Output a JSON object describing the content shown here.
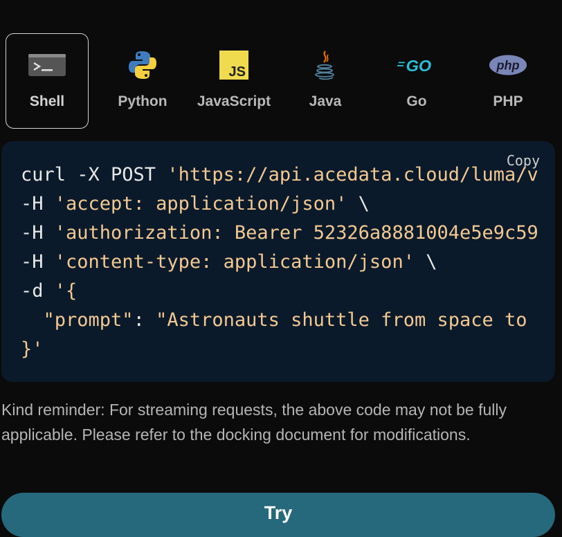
{
  "tabs": [
    {
      "label": "Shell",
      "icon": "terminal-icon",
      "active": true
    },
    {
      "label": "Python",
      "icon": "python-logo-icon",
      "active": false
    },
    {
      "label": "JavaScript",
      "icon": "javascript-logo-icon",
      "active": false
    },
    {
      "label": "Java",
      "icon": "java-logo-icon",
      "active": false
    },
    {
      "label": "Go",
      "icon": "go-logo-icon",
      "active": false
    },
    {
      "label": "PHP",
      "icon": "php-logo-icon",
      "active": false
    }
  ],
  "code": {
    "copy_label": "Copy",
    "line1_cmd": "curl -X POST ",
    "line1_url": "'https://api.acedata.cloud/luma/v",
    "line2_flag": "-H ",
    "line2_val": "'accept: application/json'",
    "line2_tail": " \\",
    "line3_flag": "-H ",
    "line3_val": "'authorization: Bearer 52326a8881004e5e9c59",
    "line4_flag": "-H ",
    "line4_val": "'content-type: application/json'",
    "line4_tail": " \\",
    "line5_flag": "-d ",
    "line5_val": "'{",
    "line6_key": "  \"prompt\"",
    "line6_colon": ": ",
    "line6_val": "\"Astronauts shuttle from space to",
    "line7_val": "}'"
  },
  "reminder": "Kind reminder: For streaming requests, the above code may not be fully applicable. Please refer to the docking document for modifications.",
  "try_label": "Try",
  "colors": {
    "background": "#0b0b0b",
    "code_bg": "#0b1a2a",
    "string": "#f2c993",
    "button": "#26697c"
  }
}
